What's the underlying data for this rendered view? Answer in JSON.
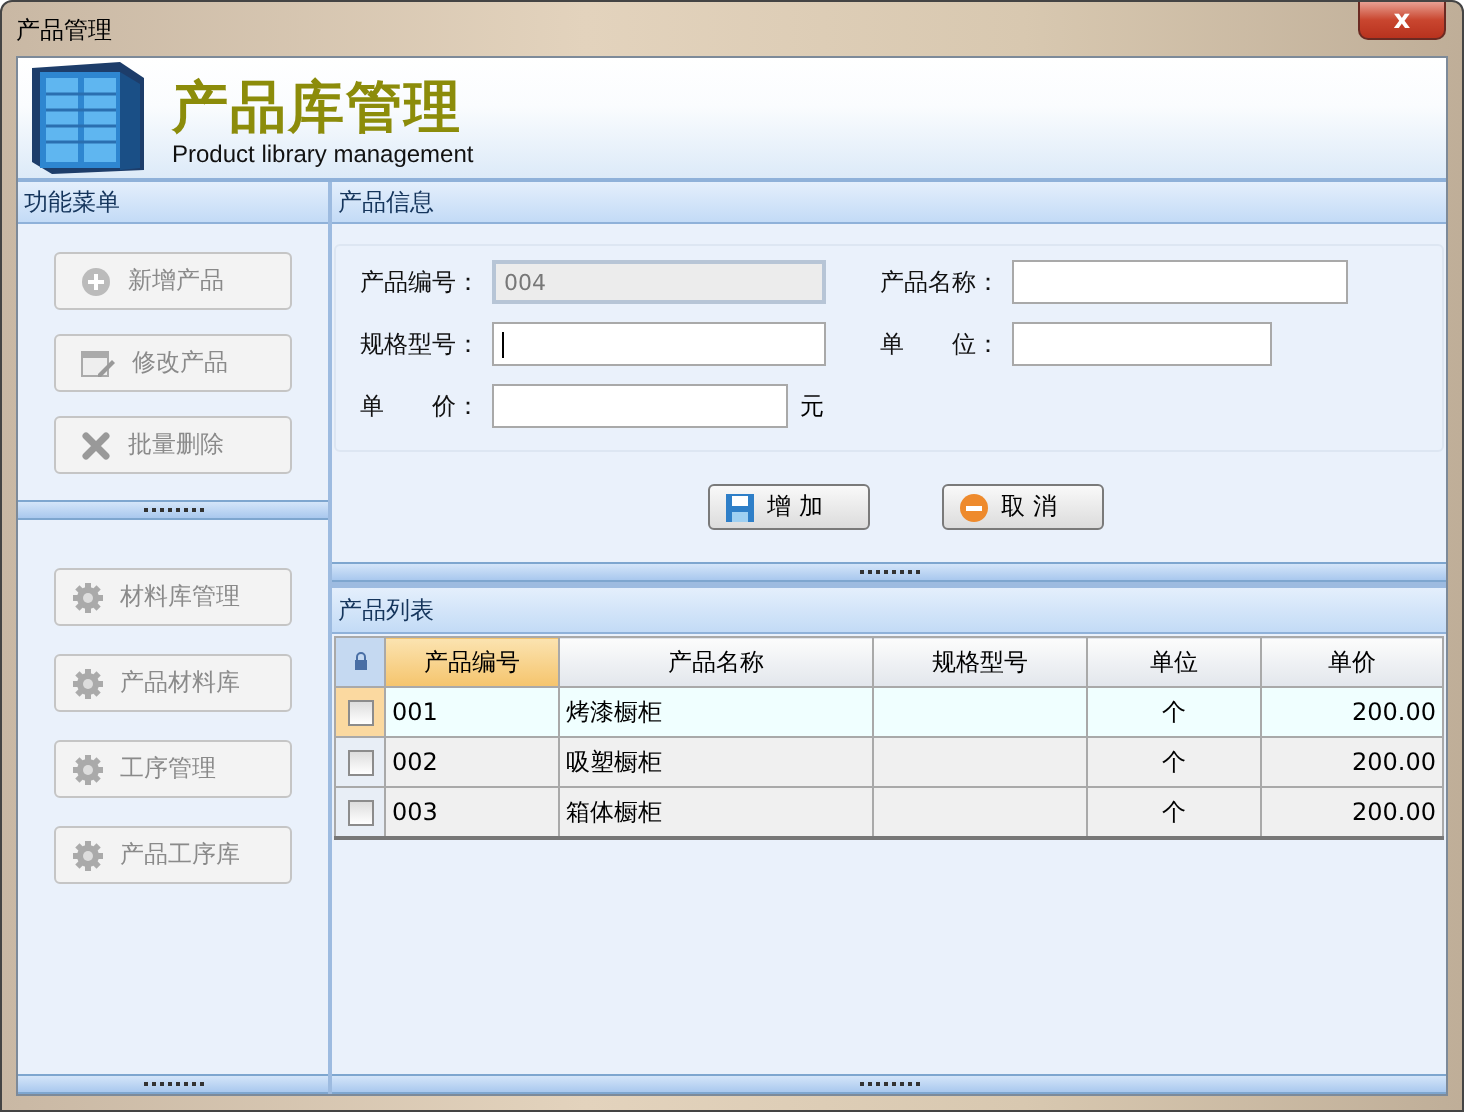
{
  "window": {
    "title": "产品管理",
    "close_button": "x"
  },
  "banner": {
    "title": "产品库管理",
    "subtitle": "Product library management"
  },
  "menu": {
    "title": "功能菜单",
    "groups": [
      [
        {
          "label": "新增产品",
          "disabled": true
        },
        {
          "label": "修改产品",
          "disabled": true
        },
        {
          "label": "批量删除",
          "disabled": true
        }
      ],
      [
        {
          "label": "材料库管理",
          "disabled": true
        },
        {
          "label": "产品材料库",
          "disabled": true
        },
        {
          "label": "工序管理",
          "disabled": true
        },
        {
          "label": "产品工序库",
          "disabled": true
        }
      ]
    ]
  },
  "product_info": {
    "title": "产品信息",
    "fields": [
      {
        "label": "产品编号：",
        "value": "004",
        "disabled": true,
        "focused": false
      },
      {
        "label": "产品名称：",
        "disabled": false,
        "focused": false
      },
      {
        "label": "规格型号：",
        "disabled": false,
        "focused": true
      },
      {
        "label": "单　　位：",
        "disabled": false,
        "focused": false
      },
      {
        "label": "单　　价：",
        "disabled": false,
        "focused": false,
        "suffix": "元"
      }
    ],
    "buttons": [
      {
        "label": "增 加"
      },
      {
        "label": "取 消"
      }
    ]
  },
  "product_list": {
    "title": "产品列表",
    "columns": [
      {
        "label": "产品编号",
        "selected": true
      },
      {
        "label": "产品名称",
        "selected": false
      },
      {
        "label": "规格型号",
        "selected": false
      },
      {
        "label": "单位",
        "selected": false
      },
      {
        "label": "单价",
        "selected": false
      }
    ],
    "rows": [
      {
        "selected": true,
        "checked": false,
        "cells": [
          "001",
          "烤漆橱柜",
          null,
          "个",
          "200.00"
        ]
      },
      {
        "selected": false,
        "checked": false,
        "cells": [
          "002",
          "吸塑橱柜",
          null,
          "个",
          "200.00"
        ]
      },
      {
        "selected": false,
        "checked": false,
        "cells": [
          "003",
          "箱体橱柜",
          null,
          "个",
          "200.00"
        ]
      }
    ]
  }
}
